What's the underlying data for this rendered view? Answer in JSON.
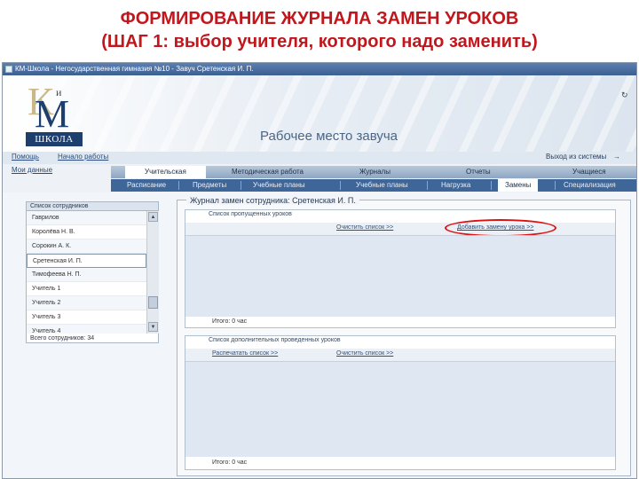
{
  "slide": {
    "title_line1": "ФОРМИРОВАНИЕ ЖУРНАЛА ЗАМЕН УРОКОВ",
    "title_line2": "(ШАГ 1: выбор учителя, которого надо заменить)"
  },
  "window": {
    "title": "КМ-Школа - Негосударственная гимназия №10 - Завуч Сретенская И. П."
  },
  "header": {
    "logo_k": "К",
    "logo_i": "и",
    "logo_m": "М",
    "logo_school": "ШКОЛА",
    "workspace_title": "Рабочее место завуча"
  },
  "nav": {
    "help": "Помощь",
    "start": "Начало работы",
    "logout": "Выход из системы",
    "logout_arrow": "→",
    "my_data": "Мои данные"
  },
  "main_tabs": [
    "Учительская",
    "Методическая работа",
    "Журналы",
    "Отчеты",
    "Учащиеся"
  ],
  "main_tabs_active": 0,
  "sub_tabs": [
    "Расписание",
    "Предметы",
    "Учебные планы",
    "Учебные планы",
    "Нагрузка",
    "Замены",
    "Специализация"
  ],
  "sub_tabs_active": 5,
  "staff": {
    "header": "Список сотрудников",
    "items": [
      "Гаврилов",
      "Королёва Н. В.",
      "Сорокин А. К.",
      "Сретенская И. П.",
      "Тимофеева Н. П.",
      "Учитель 1",
      "Учитель 2",
      "Учитель 3",
      "Учитель 4"
    ],
    "selected_index": 3,
    "total": "Всего сотрудников: 34",
    "scroll_up": "▲",
    "scroll_down": "▼"
  },
  "journal": {
    "legend": "Журнал замен сотрудника: Сретенская И. П.",
    "missed": {
      "title": "Список пропущенных уроков",
      "clear_list": "Очистить список >>",
      "add_substitution": "Добавить замену урока >>",
      "total": "Итого: 0 час"
    },
    "extra": {
      "title": "Список дополнительных проведенных уроков",
      "fill_list": "Распечатать список >>",
      "clear_list": "Очистить список >>",
      "total": "Итого: 0 час"
    }
  },
  "colors": {
    "title_red": "#c0161c",
    "nav_blue": "#3f6698",
    "highlight": "#d11111"
  }
}
